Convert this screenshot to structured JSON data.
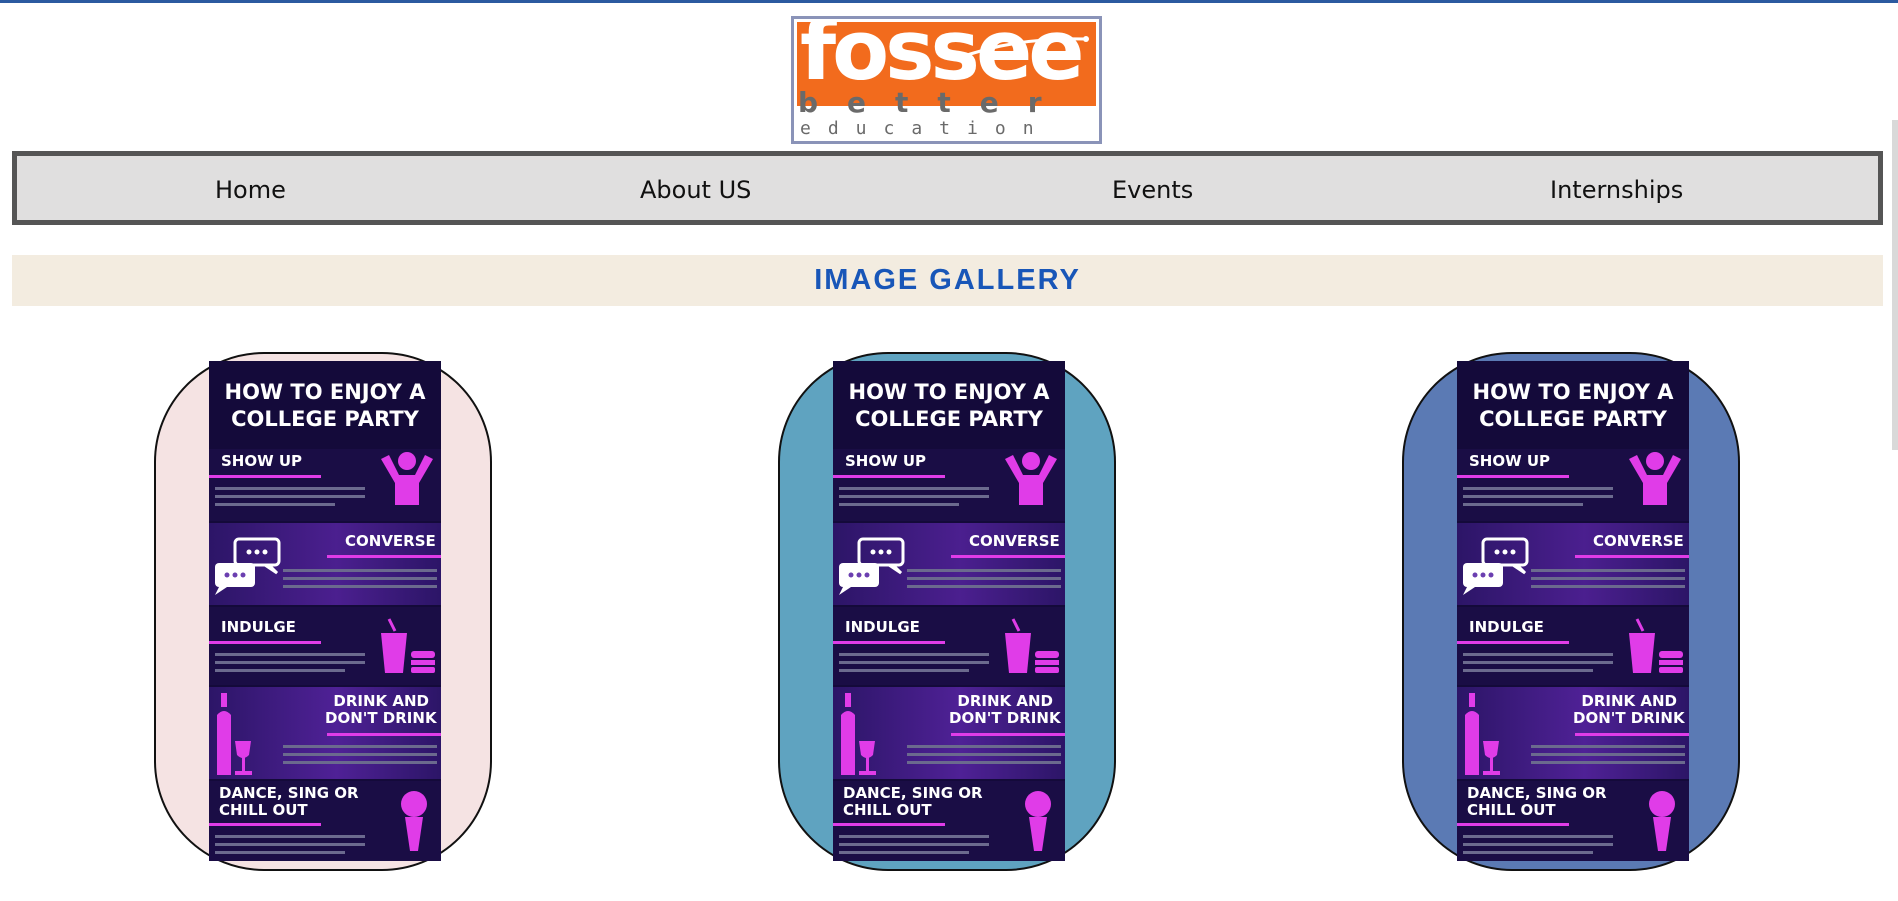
{
  "logo": {
    "word": "fossee",
    "tagline_1": "better",
    "tagline_2": "education",
    "colors": {
      "band": "#f26b1d",
      "text": "#6a6a6a",
      "border": "#8a93b8"
    }
  },
  "nav": {
    "items": [
      {
        "label": "Home"
      },
      {
        "label": "About US"
      },
      {
        "label": "Events"
      },
      {
        "label": "Internships"
      }
    ]
  },
  "gallery": {
    "title": "IMAGE GALLERY",
    "title_color": "#1856b8",
    "cards": [
      {
        "background": "#f5e3e3"
      },
      {
        "background": "#5fa3c0"
      },
      {
        "background": "#5b7ab4"
      }
    ],
    "infographic": {
      "title": "HOW TO ENJOY A COLLEGE PARTY",
      "title_line_1": "HOW TO ENJOY A",
      "title_line_2": "COLLEGE PARTY",
      "sections": [
        {
          "heading": "SHOW UP",
          "icon": "person-cheering-icon"
        },
        {
          "heading": "CONVERSE",
          "icon": "speech-bubbles-icon"
        },
        {
          "heading": "INDULGE",
          "icon": "drink-and-burger-icon"
        },
        {
          "heading_line_1": "DRINK AND",
          "heading_line_2": "DON'T DRINK",
          "icon": "bottle-and-glass-icon"
        },
        {
          "heading_line_1": "DANCE, SING OR",
          "heading_line_2": "CHILL OUT",
          "icon": "microphone-icon"
        }
      ],
      "accent_color": "#e03ce8"
    }
  }
}
